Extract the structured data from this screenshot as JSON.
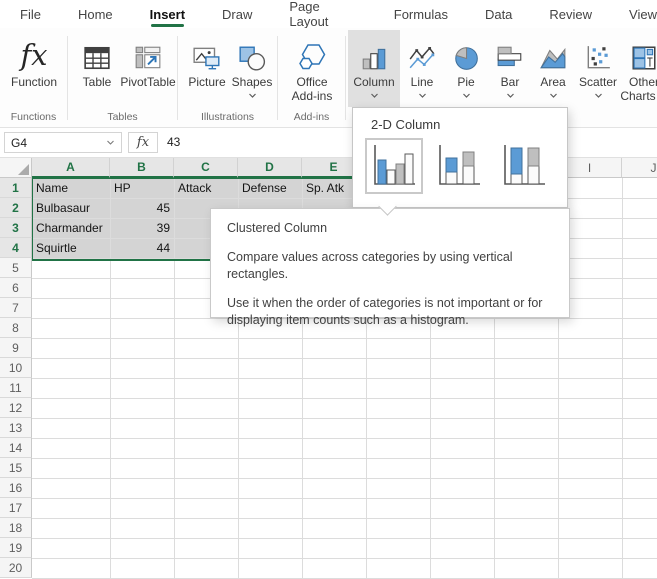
{
  "colors": {
    "excel-green": "#217346",
    "chart-blue": "#5B9BD5",
    "chart-blue-border": "#41719C",
    "chart-gray": "#BFBFBF",
    "chart-gray-border": "#7F7F7F",
    "selection-fill": "#D4D4D4"
  },
  "menu": {
    "file": "File",
    "home": "Home",
    "insert": "Insert",
    "draw": "Draw",
    "page_layout": "Page Layout",
    "formulas": "Formulas",
    "data": "Data",
    "review": "Review",
    "view": "View",
    "active_tab": "Insert"
  },
  "ribbon": {
    "fx_glyph": "fx",
    "function_label": "Function",
    "table_label": "Table",
    "pivottable_label": "PivotTable",
    "picture_label": "Picture",
    "shapes_label": "Shapes",
    "office_addins_line1": "Office",
    "office_addins_line2": "Add-ins",
    "column_label": "Column",
    "line_label": "Line",
    "pie_label": "Pie",
    "bar_label": "Bar",
    "area_label": "Area",
    "scatter_label": "Scatter",
    "other_charts_line1": "Other",
    "other_charts_line2": "Charts",
    "group_functions": "Functions",
    "group_tables": "Tables",
    "group_illustrations": "Illustrations",
    "group_addins": "Add-ins"
  },
  "formula_bar": {
    "name_box": "G4",
    "fx": "fx",
    "value": "43"
  },
  "dropdown": {
    "title": "2-D Column"
  },
  "tooltip": {
    "title": "Clustered Column",
    "line1": "Compare values across categories by using vertical rectangles.",
    "line2": "Use it when the order of categories is not important or for displaying item counts such as a histogram."
  },
  "grid": {
    "column_letters": [
      "A",
      "B",
      "C",
      "D",
      "E",
      "I",
      "J"
    ],
    "selected_columns": [
      "A",
      "B",
      "C",
      "D",
      "E"
    ],
    "row_count": 20,
    "selected_row_count": 4,
    "table": {
      "headers": [
        "Name",
        "HP",
        "Attack",
        "Defense",
        "Sp. Atk"
      ],
      "rows": [
        {
          "name": "Bulbasaur",
          "hp": "45"
        },
        {
          "name": "Charmander",
          "hp": "39"
        },
        {
          "name": "Squirtle",
          "hp": "44"
        }
      ]
    }
  }
}
